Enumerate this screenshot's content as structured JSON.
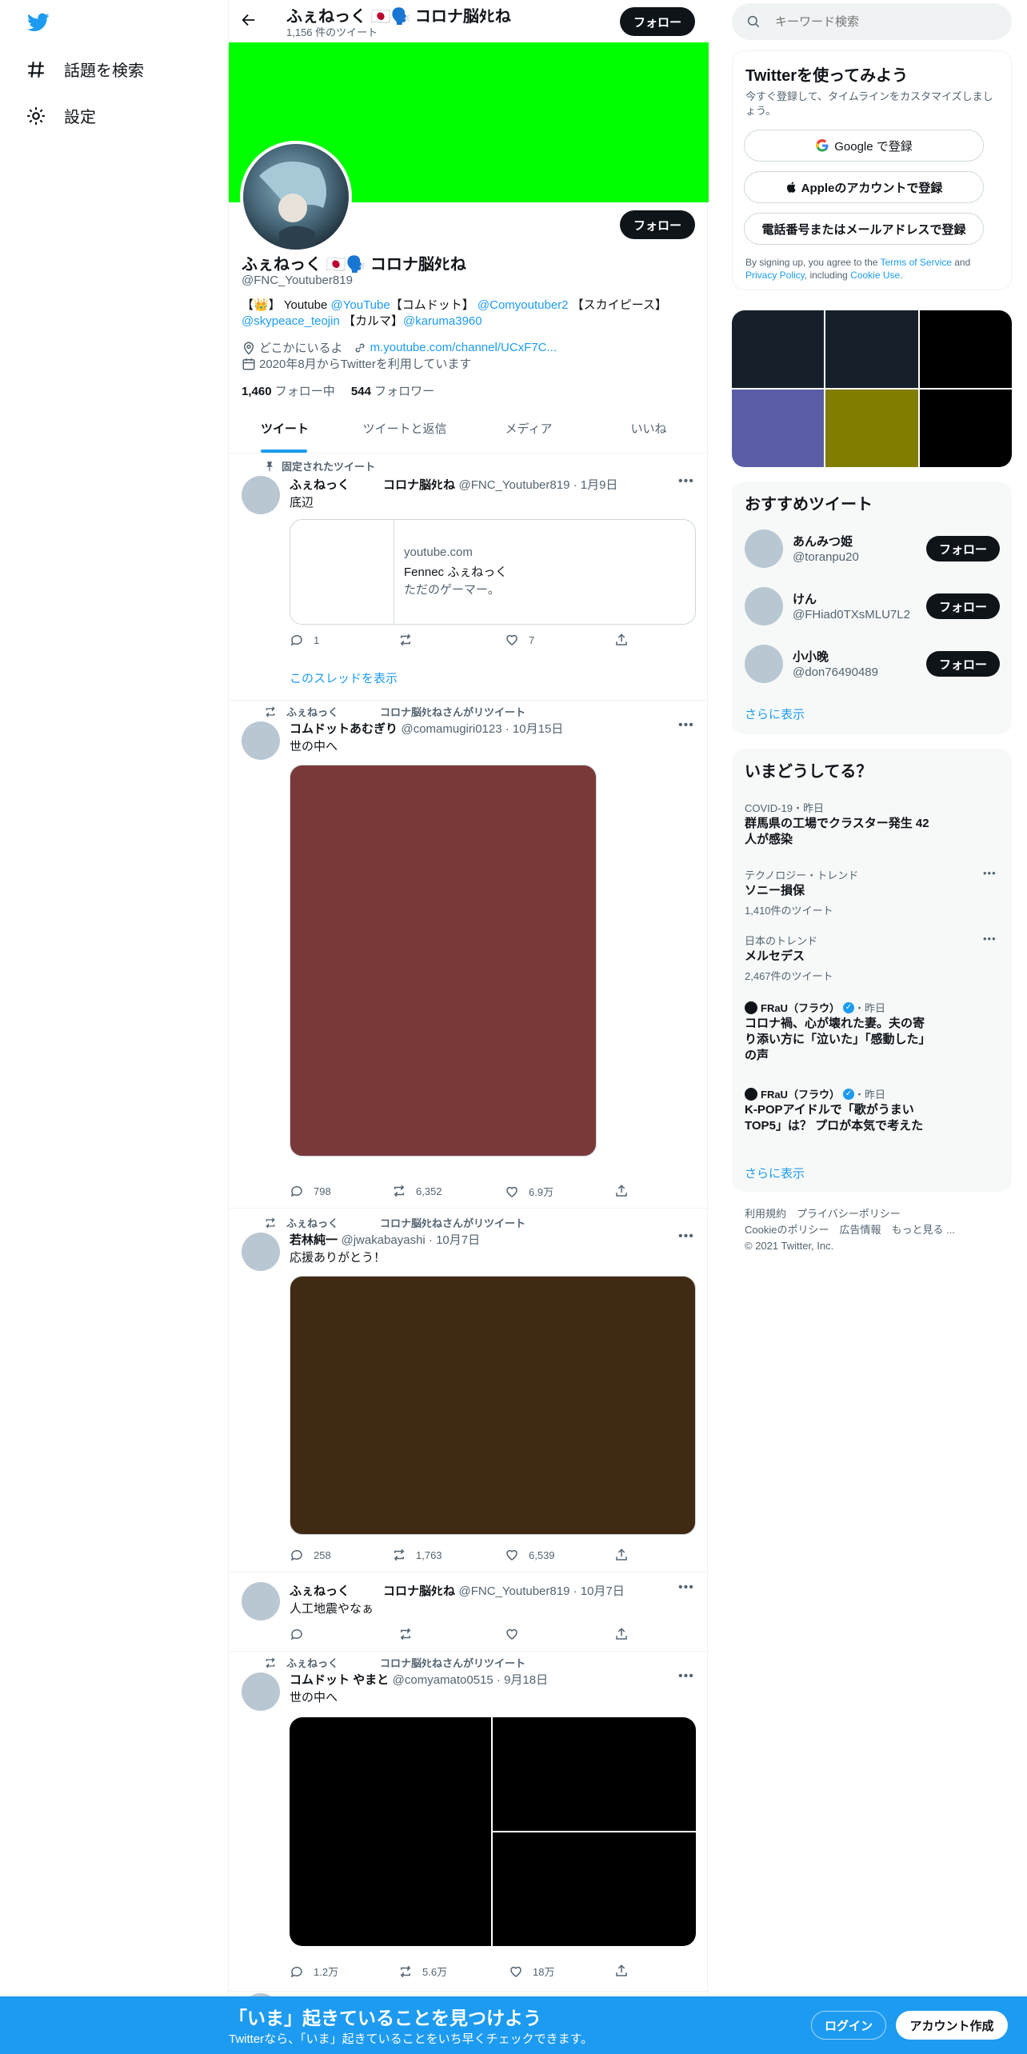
{
  "nav": {
    "explore_label": "話題を検索",
    "settings_label": "設定"
  },
  "header": {
    "display_name": "ふぇねっく 🇯🇵🗣️ コロナ脳ﾀﾋね",
    "tweet_count": "1,156 件のツイート",
    "follow_label": "フォロー"
  },
  "profile": {
    "banner_color": "#00ff00",
    "display_name": "ふぇねっく 🇯🇵🗣️ コロナ脳ﾀﾋね",
    "handle": "@FNC_Youtuber819",
    "follow_label": "フォロー",
    "bio_prefix": "【👑】 Youtube ",
    "bio_link1": "@YouTube",
    "bio_mid1": "【コムドット】 ",
    "bio_link2": "@Comyoutuber2",
    "bio_mid2": " 【スカイピース】",
    "bio_link3": "@skypeace_teojin",
    "bio_mid3": " 【カルマ】",
    "bio_link4": "@karuma3960",
    "location": "どこかにいるよ",
    "url": "m.youtube.com/channel/UCxF7C...",
    "joined": "2020年8月からTwitterを利用しています",
    "following_count": "1,460",
    "following_label": "フォロー中",
    "followers_count": "544",
    "followers_label": "フォロワー"
  },
  "tabs": [
    "ツイート",
    "ツイートと返信",
    "メディア",
    "いいね"
  ],
  "tweets": [
    {
      "pinned_label": "固定されたツイート",
      "name": "ふぇねっく",
      "name_suffix": "コロナ脳ﾀﾋね",
      "meta": "@FNC_Youtuber819 · 1月9日",
      "text": "底辺",
      "card_domain": "youtube.com",
      "card_title": "Fennec ふぇねっく",
      "card_desc": "ただのゲーマー。",
      "replies": "1",
      "retweets": "",
      "likes": "7",
      "thread_label": "このスレッドを表示"
    },
    {
      "retweeted_by": "ふぇねっく　　　　コロナ脳ﾀﾋねさんがリツイート",
      "name": "コムドットあむぎり",
      "meta": "@comamugiri0123 · 10月15日",
      "text": "世の中へ",
      "image_color": "#7a3939",
      "replies": "798",
      "retweets": "6,352",
      "likes": "6.9万"
    },
    {
      "retweeted_by": "ふぇねっく　　　　コロナ脳ﾀﾋねさんがリツイート",
      "name": "若林純一",
      "meta": "@jwakabayashi · 10月7日",
      "text": "応援ありがとう！",
      "image_color": "#412a14",
      "replies": "258",
      "retweets": "1,763",
      "likes": "6,539"
    },
    {
      "name": "ふぇねっく",
      "name_suffix": "コロナ脳ﾀﾋね",
      "meta": "@FNC_Youtuber819 · 10月7日",
      "text": "人工地震やなぁ"
    },
    {
      "retweeted_by": "ふぇねっく　　　　コロナ脳ﾀﾋねさんがリツイート",
      "name": "コムドット やまと",
      "meta": "@comyamato0515 · 9月18日",
      "text": "世の中へ",
      "replies": "1.2万",
      "retweets": "5.6万",
      "likes": "18万"
    }
  ],
  "right": {
    "search_placeholder": "キーワード検索",
    "signup": {
      "title": "Twitterを使ってみよう",
      "desc": "今すぐ登録して、タイムラインをカスタマイズしましょう。",
      "google": "Google で登録",
      "apple": "Appleのアカウントで登録",
      "phone": "電話番号またはメールアドレスで登録",
      "legal_prefix": "By signing up, you agree to the ",
      "tos": "Terms of Service",
      "and": " and ",
      "privacy": "Privacy Policy",
      "including": ", including ",
      "cookie": "Cookie Use",
      "dot": "."
    },
    "media_colors": [
      "#16202a",
      "#16202a",
      "#000000",
      "#5b5ea6",
      "#807d00",
      "#000000"
    ],
    "recommended": {
      "title": "おすすめツイート",
      "users": [
        {
          "name": "あんみつ姫",
          "handle": "@toranpu20"
        },
        {
          "name": "けん",
          "handle": "@FHiad0TXsMLU7L2"
        },
        {
          "name": "小小晚",
          "handle": "@don76490489"
        }
      ],
      "follow_label": "フォロー",
      "more": "さらに表示"
    },
    "trends": {
      "title": "いまどうしてる？",
      "items": [
        {
          "meta": "COVID-19・昨日",
          "title": "群馬県の工場でクラスター発生 42人が感染"
        },
        {
          "meta": "テクノロジー・トレンド",
          "title": "ソニー損保",
          "count": "1,410件のツイート"
        },
        {
          "meta": "日本のトレンド",
          "title": "メルセデス",
          "count": "2,467件のツイート"
        },
        {
          "source": "FRaU（フラウ）",
          "time": "・昨日",
          "title": "コロナ禍、心が壊れた妻。夫の寄り添い方に「泣いた」「感動した」の声"
        },
        {
          "source": "FRaU（フラウ）",
          "time": "・昨日",
          "title": "K-POPアイドルで「歌がうまいTOP5」は？ プロが本気で考えた"
        }
      ],
      "more": "さらに表示"
    },
    "footer": {
      "line1": "利用規約　プライバシーポリシー",
      "line2": "Cookieのポリシー　広告情報　もっと見る ...",
      "line3": "© 2021 Twitter, Inc."
    }
  },
  "bottom": {
    "title": "「いま」起きていることを見つけよう",
    "subtitle": "Twitterなら、「いま」起きていることをいち早くチェックできます。",
    "login": "ログイン",
    "signup": "アカウント作成"
  }
}
